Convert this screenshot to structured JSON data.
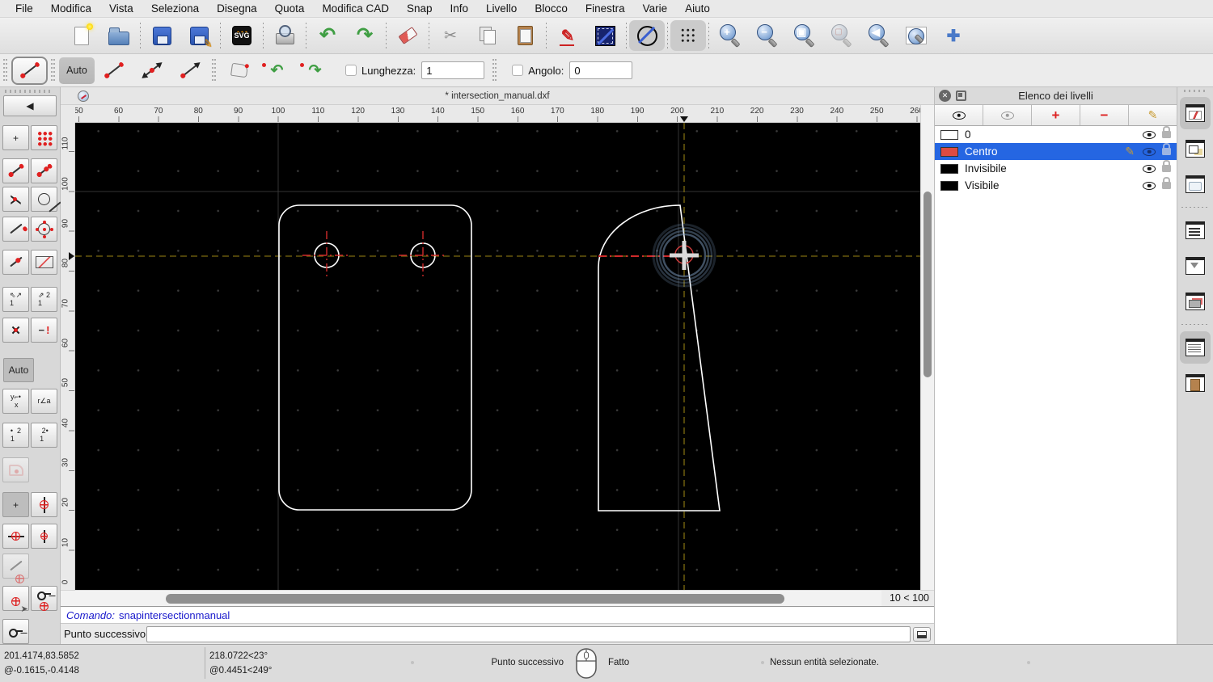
{
  "menu": {
    "items": [
      "File",
      "Modifica",
      "Vista",
      "Seleziona",
      "Disegna",
      "Quota",
      "Modifica CAD",
      "Snap",
      "Info",
      "Livello",
      "Blocco",
      "Finestra",
      "Varie",
      "Aiuto"
    ]
  },
  "main_toolbar": {
    "svg_label": "SVG",
    "buttons": [
      {
        "n": "new-file"
      },
      {
        "n": "open-file"
      },
      {
        "n": "save",
        "sep": true
      },
      {
        "n": "save-as"
      },
      {
        "n": "export-svg",
        "sep": true
      },
      {
        "n": "print-preview",
        "sep": true
      },
      {
        "n": "undo",
        "sep": true
      },
      {
        "n": "redo"
      },
      {
        "n": "eraser",
        "sep": true
      },
      {
        "n": "cut",
        "sep": true
      },
      {
        "n": "copy"
      },
      {
        "n": "paste"
      },
      {
        "n": "edit-pen",
        "sep": true
      },
      {
        "n": "draw-line"
      },
      {
        "n": "circle-line-tool",
        "sep": true,
        "pressed": true
      },
      {
        "n": "grid-toggle",
        "sep": true,
        "pressed": true
      },
      {
        "n": "zoom-in",
        "sep": true
      },
      {
        "n": "zoom-out"
      },
      {
        "n": "zoom-auto"
      },
      {
        "n": "zoom-selection",
        "disabled": true
      },
      {
        "n": "zoom-previous"
      },
      {
        "n": "zoom-window"
      },
      {
        "n": "pan"
      }
    ]
  },
  "icons": {
    "undo": "↶",
    "redo": "↷",
    "cut": "✂",
    "edit-pen": "✎",
    "save-as-badge": "✎",
    "zoom-in": "+",
    "zoom-out": "−",
    "zoom-auto": "▣",
    "zoom-selection": "▢",
    "zoom-previous": "◀",
    "zoom-window": "",
    "pan": "✚",
    "back": "◀",
    "close": "✕",
    "snap-free": "+",
    "restrict-nothing": "+",
    "intersection": "✕"
  },
  "options_toolbar": {
    "auto_label": "Auto",
    "lunghezza_label": "Lunghezza:",
    "lunghezza_value": "1",
    "angolo_label": "Angolo:",
    "angolo_value": "0"
  },
  "snap_sidebar": {
    "auto_label": "Auto"
  },
  "canvas": {
    "title": "* intersection_manual.dxf",
    "zoom_indicator": "10 < 100",
    "ruler_h": [
      "50",
      "60",
      "70",
      "80",
      "90",
      "100",
      "110",
      "120",
      "130",
      "140",
      "150",
      "160",
      "170",
      "180",
      "190",
      "200",
      "210",
      "220",
      "230",
      "240",
      "250",
      "260"
    ],
    "ruler_v": [
      "110",
      "100",
      "90",
      "80",
      "70",
      "60",
      "50",
      "40",
      "30",
      "20",
      "10",
      "0"
    ]
  },
  "layer_panel": {
    "title": "Elenco dei livelli",
    "layers": [
      {
        "name": "0",
        "color": "#ffffff",
        "selected": false
      },
      {
        "name": "Centro",
        "color": "#dd4b42",
        "selected": true
      },
      {
        "name": "Invisibile",
        "color": "#000000",
        "selected": false
      },
      {
        "name": "Visibile",
        "color": "#000000",
        "selected": false
      }
    ]
  },
  "right_strip": {
    "buttons": [
      {
        "n": "property-editor",
        "cls": "w-pen",
        "pressed": true
      },
      {
        "n": "block-list",
        "cls": "w-shapes"
      },
      {
        "n": "library-browser",
        "cls": "w-plain"
      },
      {
        "n": "widget-list",
        "cls": "w-list",
        "sep": true
      },
      {
        "n": "selection-filter",
        "cls": "w-funnel"
      },
      {
        "n": "pen-palette",
        "cls": "w-wall"
      },
      {
        "n": "command-widget",
        "cls": "w-cmd",
        "pressed": true,
        "sep": true
      },
      {
        "n": "clipboard-widget",
        "cls": "w-clip"
      }
    ]
  },
  "command_area": {
    "prompt_label": "Comando:",
    "command": "snapintersectionmanual",
    "input_label": "Punto successivo:",
    "input_value": ""
  },
  "status_bar": {
    "abs_coord": "201.4174,83.5852",
    "rel_coord": "@-0.1615,-0.4148",
    "abs_polar": "218.0722<23°",
    "rel_polar": "@0.4451<249°",
    "left_click_action": "Punto successivo",
    "right_click_action": "Fatto",
    "selection_status": "Nessun entità selezionate."
  },
  "colors": {
    "selection_blue": "#2566e2",
    "layer_centro_red": "#dd4b42",
    "centerline_red": "#cf2b2b",
    "guide_olive": "#7d6b10",
    "snap_glow_blue": "#7fa0c4",
    "canvas_black": "#000000",
    "drawing_white": "#ffffff"
  }
}
